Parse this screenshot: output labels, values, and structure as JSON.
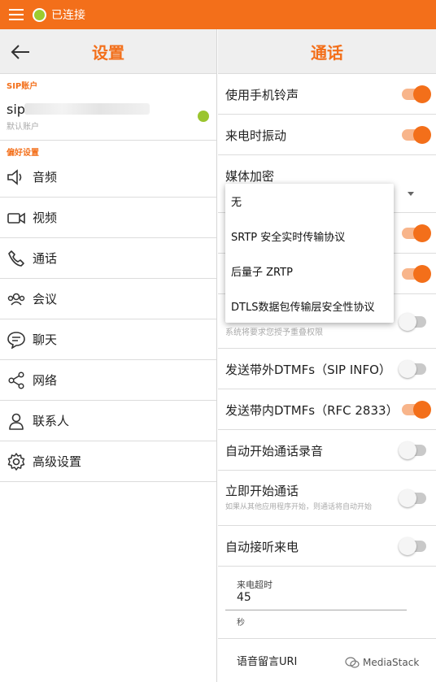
{
  "status_bar": {
    "status_text": "已连接"
  },
  "left": {
    "title": "设置",
    "sip_section_label": "SIP账户",
    "account": {
      "name": "sip",
      "subtitle": "默认账户"
    },
    "pref_section_label": "偏好设置",
    "items": [
      {
        "label": "音频",
        "icon": "speaker-icon"
      },
      {
        "label": "视频",
        "icon": "video-camera-icon"
      },
      {
        "label": "通话",
        "icon": "phone-icon"
      },
      {
        "label": "会议",
        "icon": "group-icon"
      },
      {
        "label": "聊天",
        "icon": "chat-bubble-icon"
      },
      {
        "label": "网络",
        "icon": "share-icon"
      },
      {
        "label": "联系人",
        "icon": "person-icon"
      },
      {
        "label": "高级设置",
        "icon": "gear-icon"
      }
    ]
  },
  "right": {
    "title": "通话",
    "use_ringtone": {
      "label": "使用手机铃声",
      "on": true
    },
    "vibrate": {
      "label": "来电时振动",
      "on": true
    },
    "media_encryption": {
      "label": "媒体加密"
    },
    "hidden_toggle_1": {
      "on": true
    },
    "hidden_toggle_2": {
      "on": true
    },
    "overlay": {
      "subtitle": "系统将要求您授予重叠权限",
      "on": false
    },
    "dtmf_sip_info": {
      "label": "发送带外DTMFs（SIP INFO）",
      "on": false
    },
    "dtmf_rfc2833": {
      "label": "发送带内DTMFs（RFC 2833）",
      "on": true
    },
    "auto_record": {
      "label": "自动开始通话录音",
      "on": false
    },
    "start_call_now": {
      "label": "立即开始通话",
      "subtitle": "如果从其他应用程序开始，则通话将自动开始",
      "on": false
    },
    "auto_answer": {
      "label": "自动接听来电",
      "on": false
    },
    "incoming_timeout": {
      "label": "来电超时",
      "value": "45",
      "unit": "秒"
    },
    "voicemail_uri": {
      "label": "语音留言URI"
    }
  },
  "dropdown": {
    "options": [
      "无",
      "SRTP 安全实时传输协议",
      "后量子 ZRTP",
      "DTLS数据包传输层安全性协议"
    ]
  },
  "watermark": {
    "text": "MediaStack"
  },
  "colors": {
    "accent": "#f36f1a",
    "status_green": "#9ccc2f",
    "header_bg": "#efefef"
  }
}
